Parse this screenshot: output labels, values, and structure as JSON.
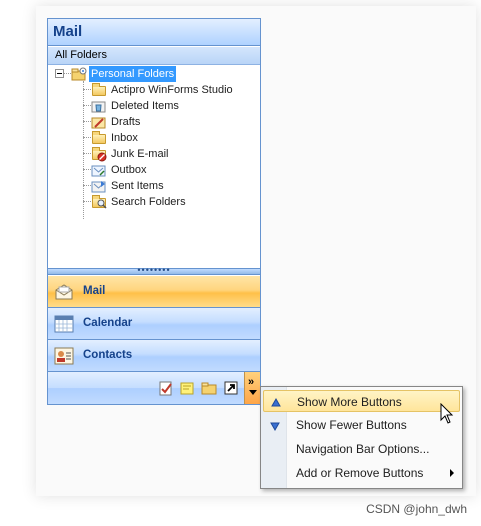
{
  "pane": {
    "title": "Mail",
    "subheader": "All Folders",
    "tree": [
      {
        "label": "Personal Folders",
        "icon": "personal-folders-icon"
      },
      {
        "label": "Actipro WinForms Studio",
        "icon": "folder-icon"
      },
      {
        "label": "Deleted Items",
        "icon": "deleted-items-icon"
      },
      {
        "label": "Drafts",
        "icon": "drafts-icon"
      },
      {
        "label": "Inbox",
        "icon": "inbox-icon"
      },
      {
        "label": "Junk E-mail",
        "icon": "junk-email-icon"
      },
      {
        "label": "Outbox",
        "icon": "outbox-icon"
      },
      {
        "label": "Sent Items",
        "icon": "sent-items-icon"
      },
      {
        "label": "Search Folders",
        "icon": "search-folders-icon"
      }
    ],
    "splitter_grip": "••••••••",
    "buttons": [
      {
        "label": "Mail",
        "icon": "mail-icon"
      },
      {
        "label": "Calendar",
        "icon": "calendar-icon"
      },
      {
        "label": "Contacts",
        "icon": "contacts-icon"
      }
    ],
    "overflow_glyph": "»"
  },
  "menu": {
    "items": [
      {
        "label": "Show More Buttons",
        "icon": "show-more-icon"
      },
      {
        "label": "Show Fewer Buttons",
        "icon": "show-fewer-icon"
      },
      {
        "label": "Navigation Bar Options...",
        "icon": ""
      },
      {
        "label": "Add or Remove Buttons",
        "icon": "submenu-arrow-icon"
      }
    ]
  },
  "watermark": "CSDN @john_dwh",
  "colors": {
    "accent_border": "#6593cf",
    "title_text": "#15428b",
    "selection": "#3399ff",
    "active_button": "#ffc048",
    "menu_hover": "#ffe59b"
  }
}
